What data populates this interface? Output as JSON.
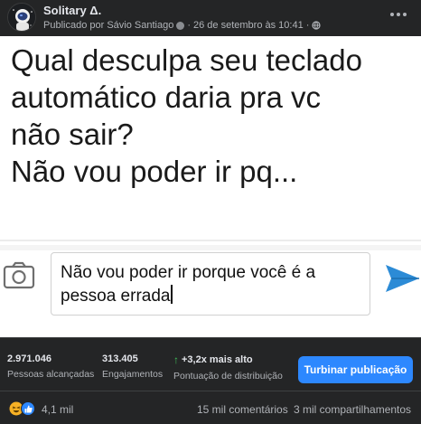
{
  "post": {
    "page_name": "Solitary Δ.",
    "published_by": "Publicado por Sávio Santiago",
    "date": "26 de setembro às 10:41",
    "separator": "·"
  },
  "image": {
    "question_text": "Qual desculpa seu teclado\nautomático daria pra vc\nnão sair?\nNão vou poder ir pq...",
    "input_text": "Não vou poder ir porque você é a\npessoa errada"
  },
  "stats": {
    "reach_value": "2.971.046",
    "reach_label": "Pessoas alcançadas",
    "engagement_value": "313.405",
    "engagement_label": "Engajamentos",
    "distribution_value": "+3,2x mais alto",
    "distribution_label": "Pontuação de distribuição",
    "boost_label": "Turbinar publicação"
  },
  "engagement": {
    "reactions_count": "4,1 mil",
    "comments": "15 mil comentários",
    "shares": "3 mil compartilhamentos"
  },
  "colors": {
    "background": "#242526",
    "accent": "#2d88ff",
    "positive": "#3fbe5a"
  },
  "icons": [
    "astronaut-avatar",
    "globe-icon",
    "more-icon",
    "camera-icon",
    "send-icon",
    "haha-reaction-icon",
    "like-reaction-icon",
    "up-arrow-icon"
  ]
}
